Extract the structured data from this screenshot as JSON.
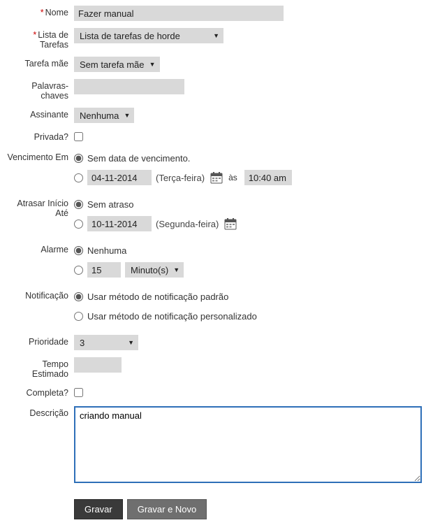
{
  "labels": {
    "nome": "Nome",
    "lista_tarefas": "Lista de Tarefas",
    "tarefa_mae": "Tarefa mãe",
    "palavras_chaves": "Palavras-chaves",
    "assinante": "Assinante",
    "privada": "Privada?",
    "vencimento_em": "Vencimento Em",
    "atrasar_inicio": "Atrasar Início Até",
    "alarme": "Alarme",
    "notificacao": "Notificação",
    "prioridade": "Prioridade",
    "tempo_estimado": "Tempo Estimado",
    "completa": "Completa?",
    "descricao": "Descrição"
  },
  "values": {
    "nome": "Fazer manual",
    "lista_tarefas": "Lista de tarefas de horde",
    "tarefa_mae": "Sem tarefa mãe",
    "palavras_chaves": "",
    "assinante": "Nenhuma",
    "privada_checked": false,
    "vencimento": {
      "sem_data_label": "Sem data de vencimento.",
      "selected": "sem_data",
      "data": "04-11-2014",
      "dia_semana": "(Terça-feira)",
      "as_label": "às",
      "hora": "10:40 am"
    },
    "atrasar": {
      "sem_atraso_label": "Sem atraso",
      "selected": "sem_atraso",
      "data": "10-11-2014",
      "dia_semana": "(Segunda-feira)"
    },
    "alarme": {
      "nenhuma_label": "Nenhuma",
      "selected": "nenhuma",
      "valor": "15",
      "unidade": "Minuto(s)"
    },
    "notificacao": {
      "selected": "padrao",
      "padrao_label": "Usar método de notificação padrão",
      "personalizado_label": "Usar método de notificação personalizado"
    },
    "prioridade": "3",
    "tempo_estimado": "",
    "completa_checked": false,
    "descricao": "criando manual"
  },
  "buttons": {
    "gravar": "Gravar",
    "gravar_novo": "Gravar e Novo"
  }
}
